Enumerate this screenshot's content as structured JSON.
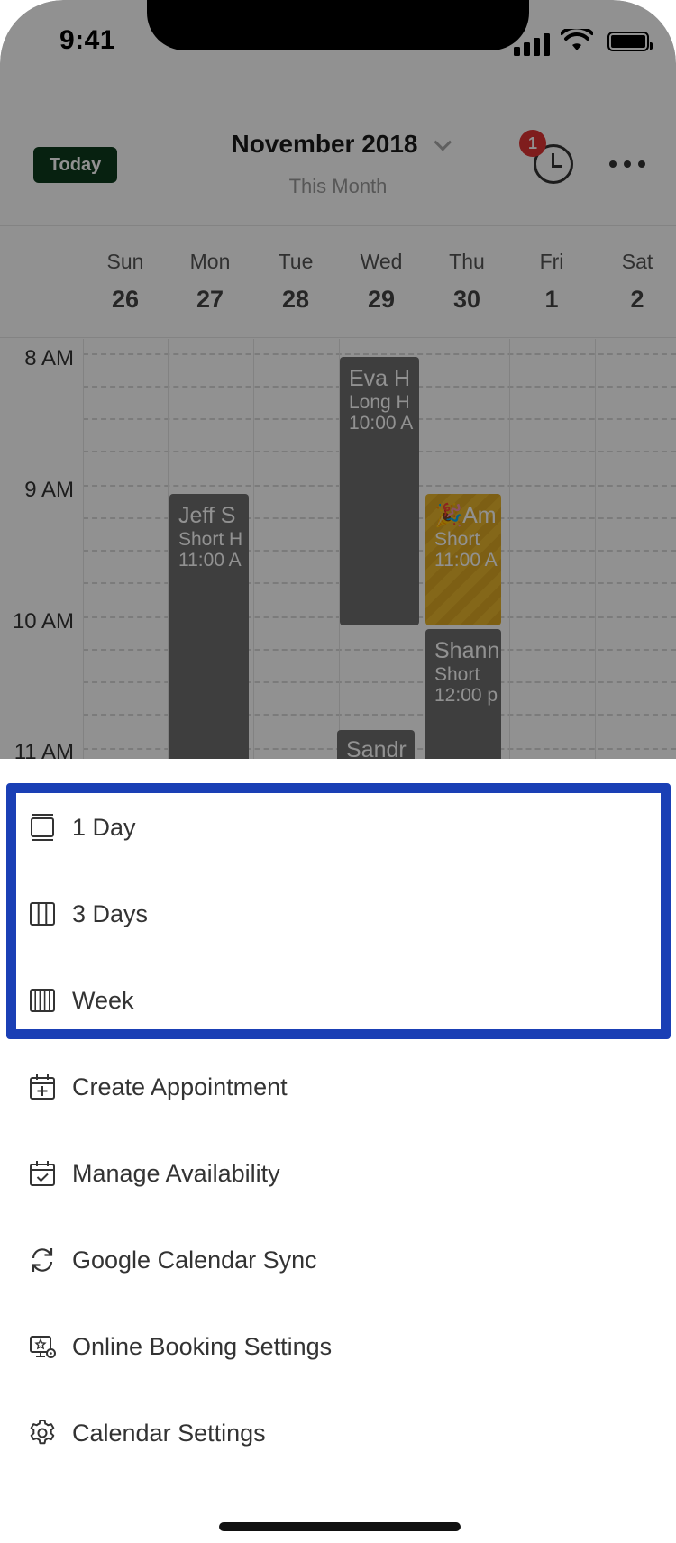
{
  "status_bar": {
    "time": "9:41"
  },
  "header": {
    "today_label": "Today",
    "month_title": "November 2018",
    "month_subtitle": "This Month",
    "notification_count": "1"
  },
  "week_days": [
    {
      "name": "Sun",
      "num": "26"
    },
    {
      "name": "Mon",
      "num": "27"
    },
    {
      "name": "Tue",
      "num": "28"
    },
    {
      "name": "Wed",
      "num": "29"
    },
    {
      "name": "Thu",
      "num": "30"
    },
    {
      "name": "Fri",
      "num": "1"
    },
    {
      "name": "Sat",
      "num": "2"
    }
  ],
  "time_labels": [
    "8 AM",
    "9 AM",
    "10 AM",
    "11 AM"
  ],
  "events": [
    {
      "title": "Jeff S",
      "line1": "Short H",
      "line2": "11:00 A"
    },
    {
      "title": "Eva H",
      "line1": "Long H",
      "line2": "10:00 A"
    },
    {
      "title": "🎉Am",
      "line1": "Short",
      "line2": "11:00 A"
    },
    {
      "title": "Shann",
      "line1": "Short",
      "line2": "12:00 p"
    },
    {
      "title": "Sandr",
      "line1": "",
      "line2": ""
    }
  ],
  "menu": {
    "items": [
      {
        "label": "1 Day",
        "icon": "day-view-icon"
      },
      {
        "label": "3 Days",
        "icon": "three-days-view-icon"
      },
      {
        "label": "Week",
        "icon": "week-view-icon"
      },
      {
        "label": "Create Appointment",
        "icon": "calendar-plus-icon"
      },
      {
        "label": "Manage Availability",
        "icon": "calendar-check-icon"
      },
      {
        "label": "Google Calendar Sync",
        "icon": "sync-icon"
      },
      {
        "label": "Online Booking Settings",
        "icon": "online-booking-icon"
      },
      {
        "label": "Calendar Settings",
        "icon": "gear-icon"
      }
    ]
  },
  "colors": {
    "highlight": "#1a3fb5",
    "today_button": "#0d3b1d",
    "badge": "#e03333",
    "event_gray": "#6e6e6e",
    "event_gold": "#e8b62c"
  }
}
